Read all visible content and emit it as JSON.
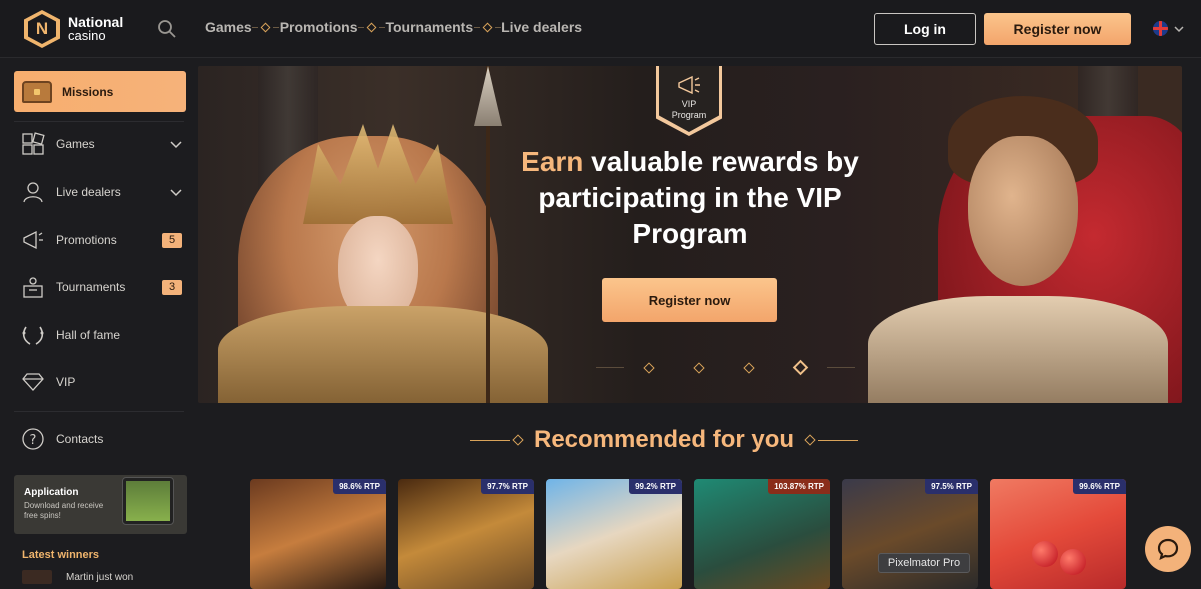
{
  "header": {
    "logo_line1": "National",
    "logo_line2": "casino",
    "logo_letter": "N",
    "nav": [
      "Games",
      "Promotions",
      "Tournaments",
      "Live dealers"
    ],
    "login": "Log in",
    "register": "Register now"
  },
  "sidebar": {
    "missions": "Missions",
    "items": [
      {
        "label": "Games",
        "icon": "games-icon"
      },
      {
        "label": "Live dealers",
        "icon": "live-dealer-icon"
      },
      {
        "label": "Promotions",
        "icon": "megaphone-icon",
        "badge": "5"
      },
      {
        "label": "Tournaments",
        "icon": "tournament-icon",
        "badge": "3"
      },
      {
        "label": "Hall of fame",
        "icon": "laurel-icon"
      },
      {
        "label": "VIP",
        "icon": "diamond-icon"
      },
      {
        "label": "Contacts",
        "icon": "question-icon"
      }
    ],
    "app_title": "Application",
    "app_sub": "Download and receive free spins!",
    "latest_winners": "Latest winners",
    "winner_text": "Martin just won"
  },
  "hero": {
    "tag": "VIP Program",
    "title_accent": "Earn",
    "title_rest": " valuable rewards by participating in the VIP Program",
    "cta": "Register now"
  },
  "recommended": {
    "title": "Recommended for you",
    "games": [
      {
        "rtp": "98.6% RTP",
        "hot": false
      },
      {
        "rtp": "97.7% RTP",
        "hot": false
      },
      {
        "rtp": "99.2% RTP",
        "hot": false
      },
      {
        "rtp": "103.87% RTP",
        "hot": true
      },
      {
        "rtp": "97.5% RTP",
        "hot": false
      },
      {
        "rtp": "99.6% RTP",
        "hot": false
      }
    ]
  },
  "tooltip": "Pixelmator Pro",
  "colors": {
    "accent": "#f6b77c",
    "background": "#1c1c1f"
  }
}
